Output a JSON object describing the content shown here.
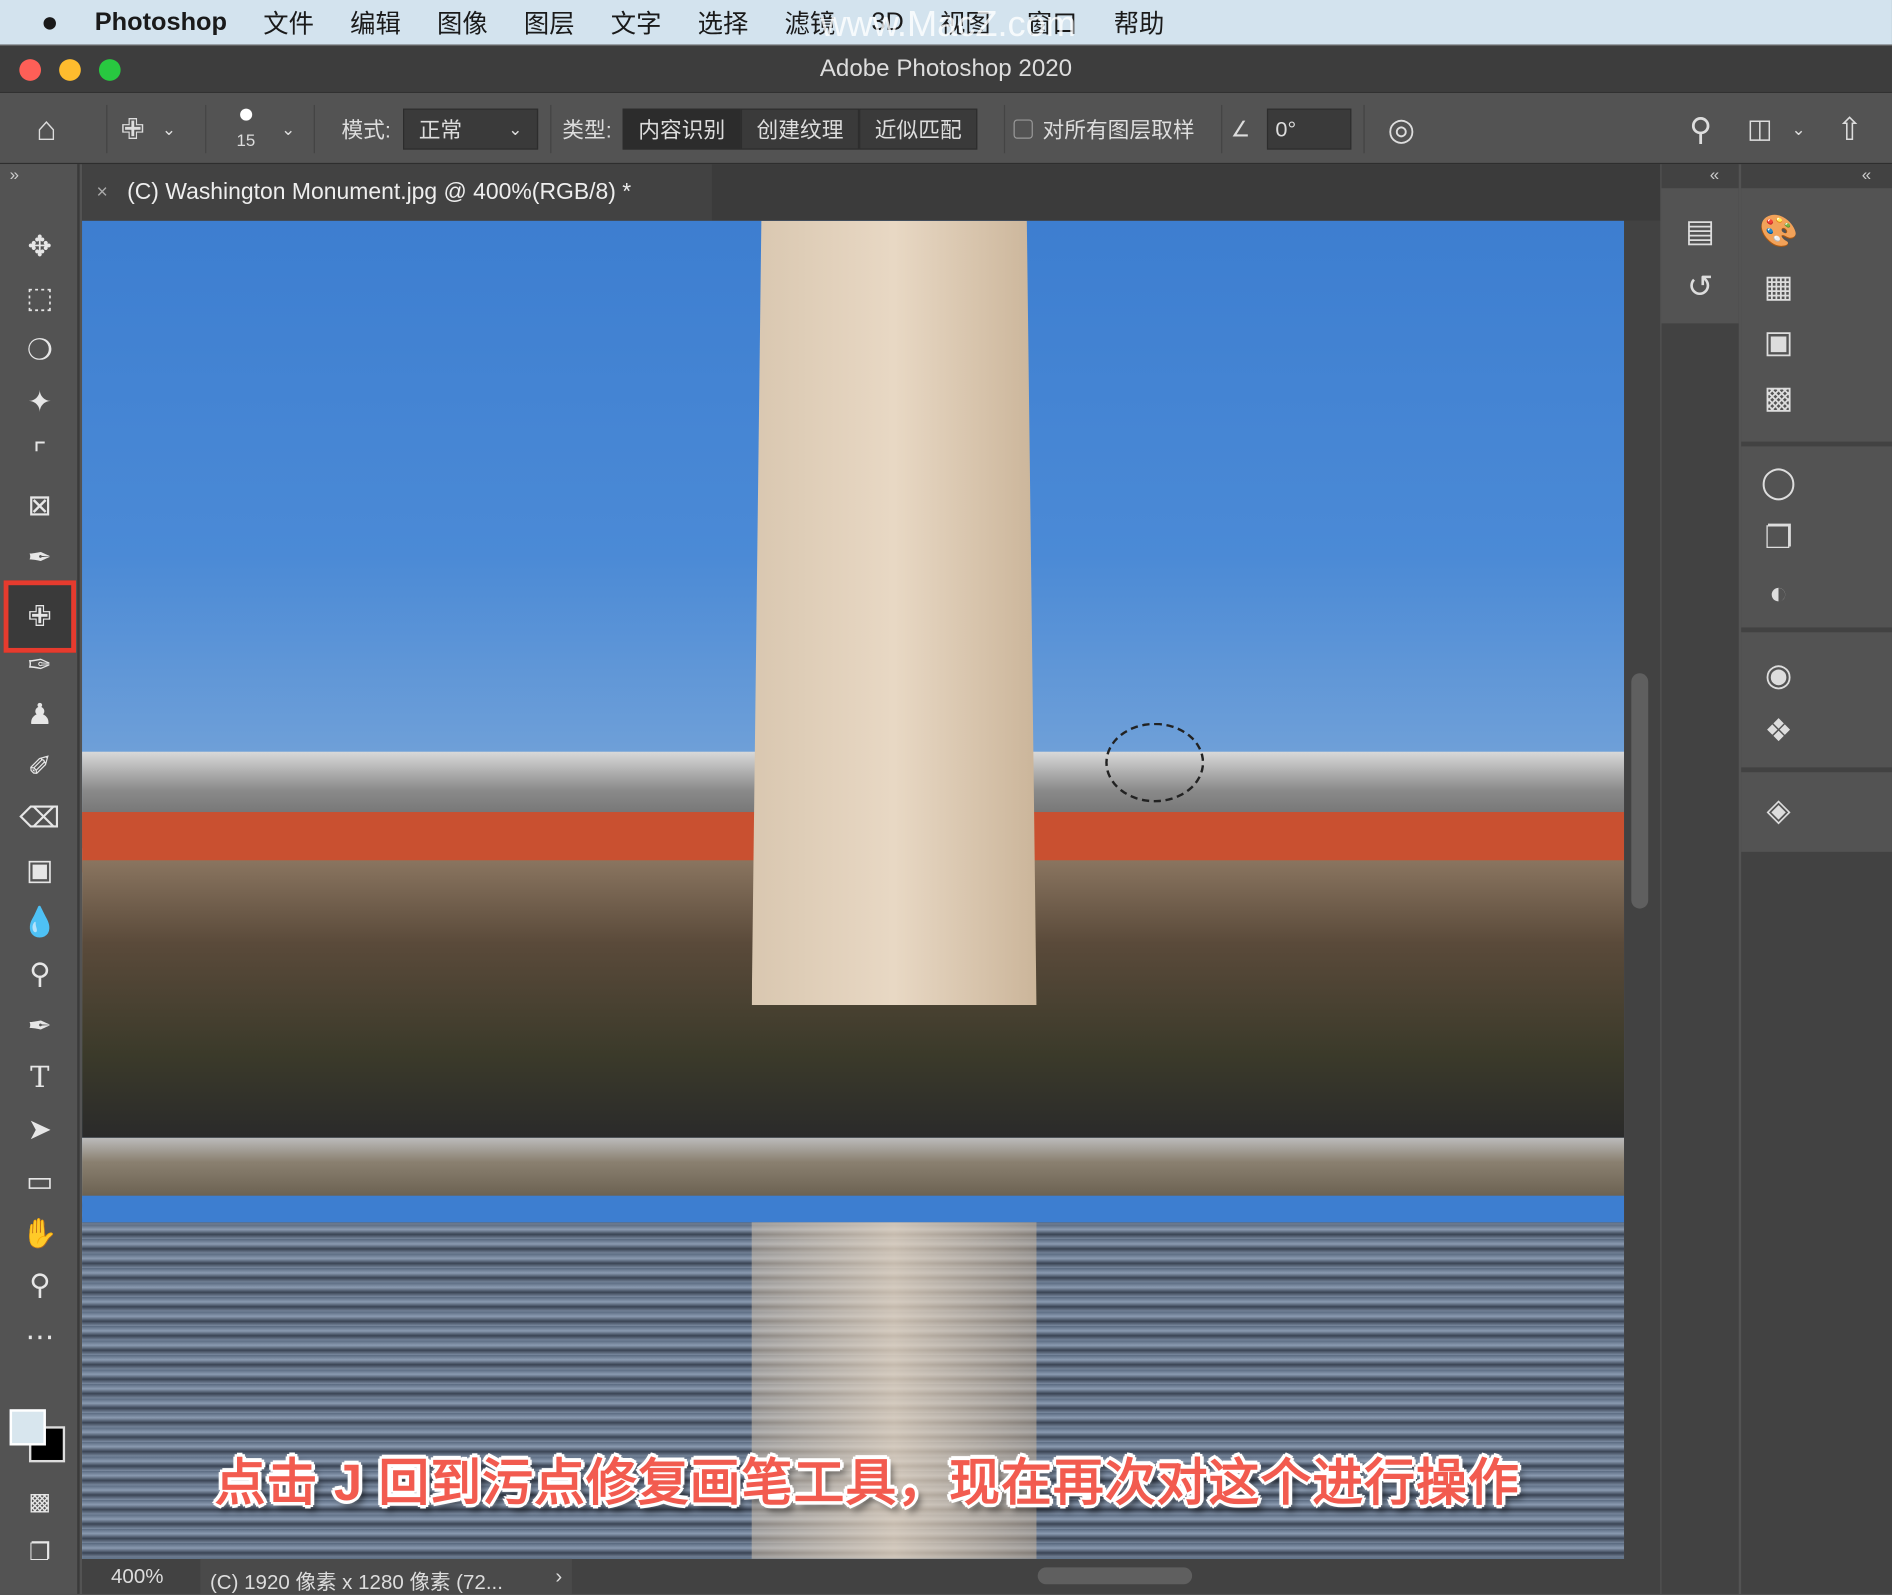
{
  "menubar": {
    "apple": "",
    "app": "Photoshop",
    "items": [
      "文件",
      "编辑",
      "图像",
      "图层",
      "文字",
      "选择",
      "滤镜",
      "3D",
      "视图",
      "窗口",
      "帮助"
    ],
    "watermark": "www.MacZ.com"
  },
  "window": {
    "title": "Adobe Photoshop 2020"
  },
  "options": {
    "brush_size": "15",
    "mode_label": "模式:",
    "mode_value": "正常",
    "type_label": "类型:",
    "types": [
      "内容识别",
      "创建纹理",
      "近似匹配"
    ],
    "selected_type": "内容识别",
    "sample_all_label": "对所有图层取样",
    "sample_all_checked": false,
    "angle_value": "0°"
  },
  "document": {
    "tab_title": "(C) Washington Monument.jpg @ 400%(RGB/8) *"
  },
  "status": {
    "zoom": "400%",
    "info": "(C) 1920 像素 x 1280 像素 (72...",
    "arrow": "›"
  },
  "caption": "点击 J 回到污点修复画笔工具，现在再次对这个进行操作",
  "tools": [
    "move",
    "marquee",
    "lasso",
    "quick-selection",
    "crop",
    "frame",
    "eyedropper",
    "spot-healing-brush",
    "brush",
    "clone-stamp",
    "history-brush",
    "eraser",
    "gradient",
    "blur",
    "dodge",
    "pen",
    "type",
    "path-selection",
    "rectangle",
    "hand",
    "zoom",
    "more"
  ],
  "active_tool": "spot-healing-brush",
  "colors": {
    "foreground": "#d8e6ee",
    "background": "#000000",
    "highlight": "#e63b2e"
  }
}
